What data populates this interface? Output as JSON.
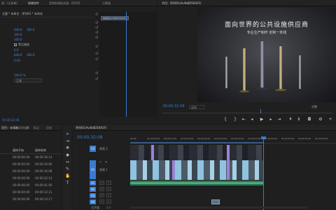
{
  "effect_controls": {
    "tab_label": "源：(无剪辑)",
    "tab2_label": "效果控件",
    "tab3_label": "音频剪辑混合器：序列01",
    "tab4_label": "元数据",
    "header": "主要 * 未命名 · 序列01 * 未命名",
    "clip_name": "未命名(Av4b6D50A2F)",
    "pos_x": "640.0",
    "pos_y": "360.0",
    "scale_w": "100.0",
    "scale_h": "100.0",
    "uniform_scale": "等比缩放",
    "rotation": "0.0",
    "anchor_x": "640.0",
    "anchor_y": "360.0",
    "flicker": "0.00",
    "opacity": "100.0 %",
    "blend_mode": "正常",
    "timecode": "00:00:32:08"
  },
  "program": {
    "tab_label": "节目：序列01(Av4b6D50A2F)",
    "headline": "面向世界的公共设施供应商",
    "subline": "专业生产制作  定制一末线",
    "timecode": "00:00:32:08",
    "fit": "适合",
    "quality": "完整",
    "duration": "00:02:24:06"
  },
  "project": {
    "tab_label": "项目：未命名",
    "tab2_label": "媒体浏览器",
    "tab3_label": "库",
    "tab4_label": "标记",
    "tab5_label": "历史",
    "col_start": "媒体开始",
    "col_end": "媒体结束",
    "rows": [
      {
        "start": "00:00:00:00",
        "end": "00:00:16:12"
      },
      {
        "start": "00:00:00:00",
        "end": "00:00:34:06"
      },
      {
        "start": "00:00:00:00",
        "end": "00:00:16:08"
      },
      {
        "start": "00:00:00:00",
        "end": "00:00:22:14"
      },
      {
        "start": "00:00:00:00",
        "end": "00:00:41:00"
      },
      {
        "start": "00:00:00:00",
        "end": "00:00:12:21"
      },
      {
        "start": "00:00:00:00",
        "end": "00:00:13:17"
      }
    ]
  },
  "timeline": {
    "tab_label": "序列01(Av4b6D50A2F)",
    "timecode": "00:00:32:08",
    "ruler": [
      "00:00",
      "00:00:05:00",
      "00:00:10:00",
      "00:00:15:00",
      "00:00:20:00",
      "00:00:25:00",
      "00:00:30:00",
      "00:00:35:00",
      "00:00:40:00",
      "00:00:45:00",
      "00:00:50:00",
      "00:00:55:00"
    ],
    "tracks": {
      "v2": "V2",
      "v1": "V1",
      "a1": "A1",
      "a2": "A2",
      "a3": "A3",
      "a4": "A4"
    },
    "v2_name": "视频 2",
    "v1_name": "视频 1",
    "master": "主声道",
    "master_val": "0.0"
  },
  "colors": {
    "accent": "#3a7ad0",
    "clip_blue": "#8fc3e0",
    "clip_purple": "#9b82d4",
    "audio_green": "#2d7d58"
  }
}
